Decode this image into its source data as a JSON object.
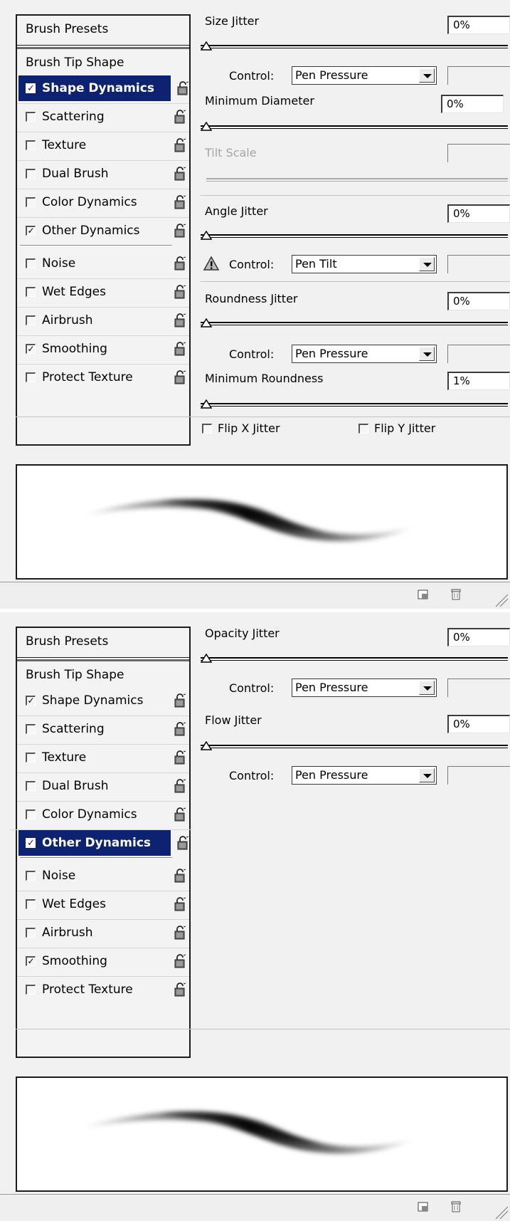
{
  "panels": [
    {
      "sidebar": {
        "presets_label": "Brush Presets",
        "tip_shape_label": "Brush Tip Shape",
        "items": [
          {
            "label": "Shape Dynamics",
            "checked": true,
            "selected": true
          },
          {
            "label": "Scattering",
            "checked": false,
            "selected": false
          },
          {
            "label": "Texture",
            "checked": false,
            "selected": false
          },
          {
            "label": "Dual Brush",
            "checked": false,
            "selected": false
          },
          {
            "label": "Color Dynamics",
            "checked": false,
            "selected": false
          },
          {
            "label": "Other Dynamics",
            "checked": true,
            "selected": false
          },
          {
            "label": "Noise",
            "checked": false,
            "selected": false
          },
          {
            "label": "Wet Edges",
            "checked": false,
            "selected": false
          },
          {
            "label": "Airbrush",
            "checked": false,
            "selected": false
          },
          {
            "label": "Smoothing",
            "checked": true,
            "selected": false
          },
          {
            "label": "Protect Texture",
            "checked": false,
            "selected": false
          }
        ]
      },
      "settings": {
        "size_jitter": {
          "label": "Size Jitter",
          "value": "0%"
        },
        "size_control": {
          "label": "Control:",
          "value": "Pen Pressure"
        },
        "min_diameter": {
          "label": "Minimum Diameter",
          "value": "0%"
        },
        "tilt_scale": {
          "label": "Tilt Scale"
        },
        "angle_jitter": {
          "label": "Angle Jitter",
          "value": "0%"
        },
        "angle_control": {
          "label": "Control:",
          "value": "Pen Tilt"
        },
        "roundness_jitter": {
          "label": "Roundness Jitter",
          "value": "0%"
        },
        "roundness_control": {
          "label": "Control:",
          "value": "Pen Pressure"
        },
        "min_roundness": {
          "label": "Minimum Roundness",
          "value": "1%"
        },
        "flip_x": {
          "label": "Flip X Jitter",
          "checked": false
        },
        "flip_y": {
          "label": "Flip Y Jitter",
          "checked": false
        }
      },
      "icons": [
        "lock-icon",
        "warning-icon",
        "new-preset-icon",
        "trash-icon",
        "resize-grip-icon"
      ]
    },
    {
      "sidebar": {
        "presets_label": "Brush Presets",
        "tip_shape_label": "Brush Tip Shape",
        "items": [
          {
            "label": "Shape Dynamics",
            "checked": true,
            "selected": false
          },
          {
            "label": "Scattering",
            "checked": false,
            "selected": false
          },
          {
            "label": "Texture",
            "checked": false,
            "selected": false
          },
          {
            "label": "Dual Brush",
            "checked": false,
            "selected": false
          },
          {
            "label": "Color Dynamics",
            "checked": false,
            "selected": false
          },
          {
            "label": "Other Dynamics",
            "checked": true,
            "selected": true
          },
          {
            "label": "Noise",
            "checked": false,
            "selected": false
          },
          {
            "label": "Wet Edges",
            "checked": false,
            "selected": false
          },
          {
            "label": "Airbrush",
            "checked": false,
            "selected": false
          },
          {
            "label": "Smoothing",
            "checked": true,
            "selected": false
          },
          {
            "label": "Protect Texture",
            "checked": false,
            "selected": false
          }
        ]
      },
      "settings": {
        "opacity_jitter": {
          "label": "Opacity Jitter",
          "value": "0%"
        },
        "opacity_control": {
          "label": "Control:",
          "value": "Pen Pressure"
        },
        "flow_jitter": {
          "label": "Flow Jitter",
          "value": "0%"
        },
        "flow_control": {
          "label": "Control:",
          "value": "Pen Pressure"
        }
      }
    }
  ],
  "colors": {
    "selection": "#0d2270",
    "panel_bg": "#f1f1f1"
  }
}
